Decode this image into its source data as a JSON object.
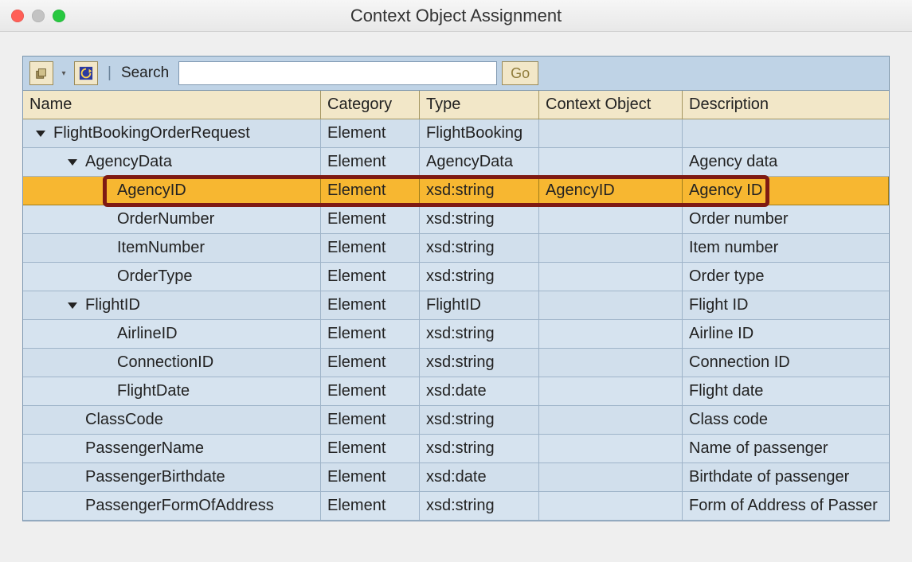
{
  "window": {
    "title": "Context Object Assignment"
  },
  "toolbar": {
    "search_label": "Search",
    "search_placeholder": "",
    "go_label": "Go"
  },
  "columns": {
    "name": "Name",
    "category": "Category",
    "type": "Type",
    "context_object": "Context Object",
    "description": "Description"
  },
  "rows": [
    {
      "name": "FlightBookingOrderRequest",
      "category": "Element",
      "type": "FlightBooking",
      "context_object": "",
      "description": "",
      "indent": 1,
      "arrow": true,
      "highlight": false
    },
    {
      "name": "AgencyData",
      "category": "Element",
      "type": "AgencyData",
      "context_object": "",
      "description": "Agency data",
      "indent": 2,
      "arrow": true,
      "highlight": false
    },
    {
      "name": "AgencyID",
      "category": "Element",
      "type": "xsd:string",
      "context_object": "AgencyID",
      "description": "Agency ID",
      "indent": 3,
      "arrow": false,
      "highlight": true
    },
    {
      "name": "OrderNumber",
      "category": "Element",
      "type": "xsd:string",
      "context_object": "",
      "description": "Order number",
      "indent": 3,
      "arrow": false,
      "highlight": false
    },
    {
      "name": "ItemNumber",
      "category": "Element",
      "type": "xsd:string",
      "context_object": "",
      "description": "Item number",
      "indent": 3,
      "arrow": false,
      "highlight": false
    },
    {
      "name": "OrderType",
      "category": "Element",
      "type": "xsd:string",
      "context_object": "",
      "description": "Order type",
      "indent": 3,
      "arrow": false,
      "highlight": false
    },
    {
      "name": "FlightID",
      "category": "Element",
      "type": "FlightID",
      "context_object": "",
      "description": "Flight ID",
      "indent": 2,
      "arrow": true,
      "highlight": false
    },
    {
      "name": "AirlineID",
      "category": "Element",
      "type": "xsd:string",
      "context_object": "",
      "description": "Airline ID",
      "indent": 3,
      "arrow": false,
      "highlight": false
    },
    {
      "name": "ConnectionID",
      "category": "Element",
      "type": "xsd:string",
      "context_object": "",
      "description": "Connection ID",
      "indent": 3,
      "arrow": false,
      "highlight": false
    },
    {
      "name": "FlightDate",
      "category": "Element",
      "type": "xsd:date",
      "context_object": "",
      "description": "Flight date",
      "indent": 3,
      "arrow": false,
      "highlight": false
    },
    {
      "name": "ClassCode",
      "category": "Element",
      "type": "xsd:string",
      "context_object": "",
      "description": "Class code",
      "indent": 2,
      "arrow": false,
      "highlight": false
    },
    {
      "name": "PassengerName",
      "category": "Element",
      "type": "xsd:string",
      "context_object": "",
      "description": "Name of passenger",
      "indent": 2,
      "arrow": false,
      "highlight": false
    },
    {
      "name": "PassengerBirthdate",
      "category": "Element",
      "type": "xsd:date",
      "context_object": "",
      "description": "Birthdate of passenger",
      "indent": 2,
      "arrow": false,
      "highlight": false
    },
    {
      "name": "PassengerFormOfAddress",
      "category": "Element",
      "type": "xsd:string",
      "context_object": "",
      "description": "Form of Address of Passer",
      "indent": 2,
      "arrow": false,
      "highlight": false
    }
  ]
}
